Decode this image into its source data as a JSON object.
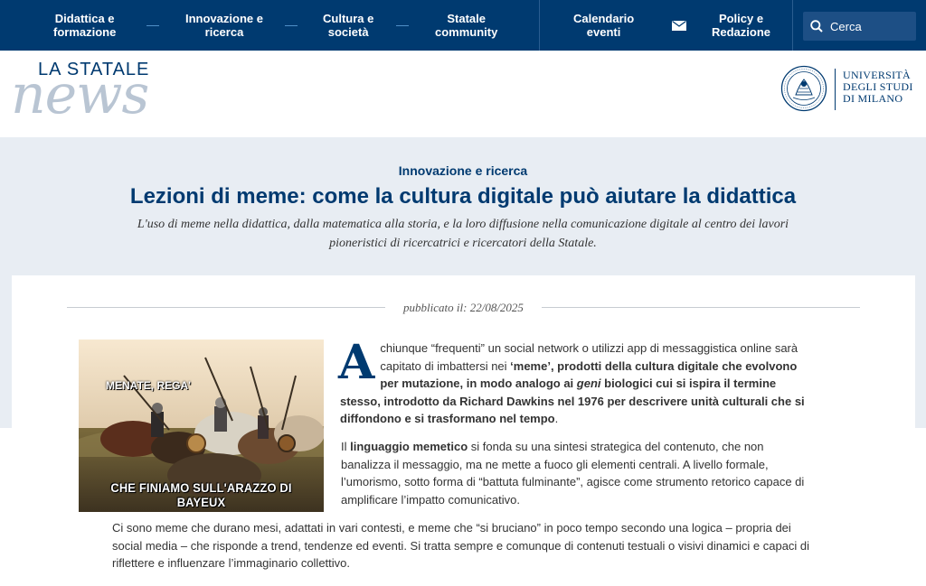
{
  "nav": {
    "items": [
      {
        "label": "Didattica e\nformazione"
      },
      {
        "label": "Innovazione e\nricerca"
      },
      {
        "label": "Cultura e\nsocietà"
      },
      {
        "label": "Statale\ncommunity"
      },
      {
        "label": "Calendario\neventi"
      },
      {
        "label": "Policy e\nRedazione"
      }
    ],
    "search_placeholder": "Cerca"
  },
  "brand": {
    "logo_top": "LA STATALE",
    "logo_news": "news",
    "university_lines": [
      "UNIVERSITÀ",
      "DEGLI STUDI",
      "DI MILANO"
    ]
  },
  "article": {
    "category": "Innovazione e ricerca",
    "title": "Lezioni di meme: come la cultura digitale può aiutare la didattica",
    "subtitle": "L'uso di meme nella didattica, dalla matematica alla storia, e la loro diffusione nella comunicazione digitale al centro dei lavori pioneristici di ricercatrici e ricercatori della Statale.",
    "published": "pubblicato il: 22/08/2025",
    "image": {
      "caption_top": "MENATE, REGA'",
      "caption_bottom": "CHE FINIAMO SULL'ARAZZO DI BAYEUX"
    },
    "p1": {
      "dropcap": "A",
      "text1": "chiunque “frequenti” un social network o utilizzi app di messaggistica online sarà capitato di imbattersi nei ",
      "bold1": "‘meme’, prodotti della cultura digitale che evolvono per mutazione, in modo analogo ai ",
      "italic1": "geni",
      "bold2": " biologici cui si ispira il termine stesso, introdotto da Richard Dawkins nel 1976 per descrivere unità culturali che si diffondono e si trasformano nel tempo",
      "text2": "."
    },
    "p2": {
      "text1": "Il ",
      "bold1": "linguaggio memetico",
      "text2": " si fonda su una sintesi strategica del contenuto, che non banalizza il messaggio, ma ne mette a fuoco gli elementi centrali. A livello formale, l’umorismo, sotto forma di “battuta fulminante”, agisce come strumento retorico capace di amplificare l’impatto comunicativo."
    },
    "p3": "Ci sono meme che durano mesi, adattati in vari contesti, e meme che “si bruciano” in poco tempo secondo una logica – propria dei social media – che risponde a trend, tendenze ed eventi. Si tratta sempre e comunque di contenuti testuali o visivi dinamici e capaci di riflettere e influenzare l’immaginario collettivo."
  },
  "colors": {
    "nav_bg": "#003a70",
    "hero_bg": "#e8edf3",
    "accent": "#003a70"
  },
  "icons": [
    "mail-icon",
    "search-icon",
    "university-seal-icon"
  ]
}
